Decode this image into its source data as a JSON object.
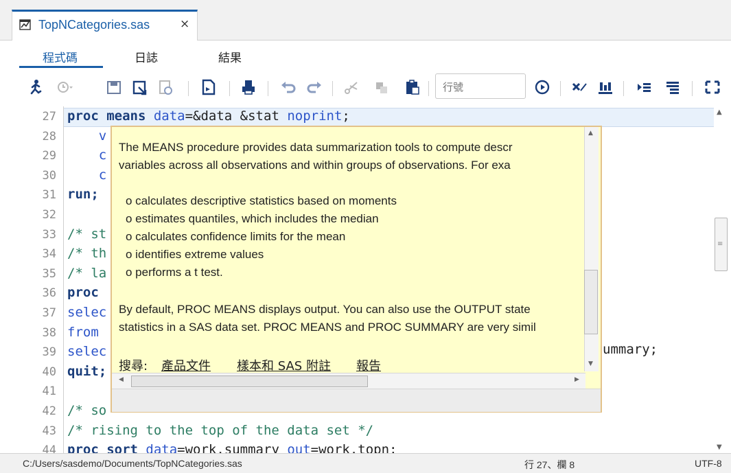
{
  "tab": {
    "filename": "TopNCategories.sas",
    "close": "×"
  },
  "subtabs": [
    "程式碼",
    "日誌",
    "結果"
  ],
  "toolbar": {
    "line_placeholder": "行號"
  },
  "editor": {
    "lines": [
      {
        "n": "27",
        "code": [
          {
            "t": "proc ",
            "c": "kw"
          },
          {
            "t": "means ",
            "c": "kw"
          },
          {
            "t": "data",
            "c": "opt"
          },
          {
            "t": "=&data &stat ",
            "c": ""
          },
          {
            "t": "noprint",
            "c": "opt"
          },
          {
            "t": ";",
            "c": ""
          }
        ]
      },
      {
        "n": "28",
        "code": [
          {
            "t": "    v",
            "c": "opt"
          }
        ]
      },
      {
        "n": "29",
        "code": [
          {
            "t": "    c",
            "c": "opt"
          }
        ]
      },
      {
        "n": "30",
        "code": [
          {
            "t": "    c",
            "c": "opt"
          }
        ]
      },
      {
        "n": "31",
        "code": [
          {
            "t": "run;",
            "c": "kw"
          }
        ]
      },
      {
        "n": "32",
        "code": []
      },
      {
        "n": "33",
        "code": [
          {
            "t": "/* st",
            "c": "cmt"
          }
        ]
      },
      {
        "n": "34",
        "code": [
          {
            "t": "/* th",
            "c": "cmt"
          }
        ]
      },
      {
        "n": "35",
        "code": [
          {
            "t": "/* la",
            "c": "cmt"
          }
        ]
      },
      {
        "n": "36",
        "code": [
          {
            "t": "proc",
            "c": "kw"
          }
        ]
      },
      {
        "n": "37",
        "code": [
          {
            "t": "selec",
            "c": "opt"
          }
        ]
      },
      {
        "n": "38",
        "code": [
          {
            "t": "from",
            "c": "opt"
          }
        ]
      },
      {
        "n": "39",
        "code": [
          {
            "t": "selec",
            "c": "opt"
          }
        ]
      },
      {
        "n": "40",
        "code": [
          {
            "t": "quit;",
            "c": "kw"
          }
        ]
      },
      {
        "n": "41",
        "code": []
      },
      {
        "n": "42",
        "code": [
          {
            "t": "/* so",
            "c": "cmt"
          }
        ]
      },
      {
        "n": "43",
        "code": [
          {
            "t": "/* rising to the top of the data set */",
            "c": "cmt"
          }
        ]
      },
      {
        "n": "44",
        "code": [
          {
            "t": "proc ",
            "c": "kw"
          },
          {
            "t": "sort ",
            "c": "kw"
          },
          {
            "t": "data",
            "c": "opt"
          },
          {
            "t": "=work.summary ",
            "c": ""
          },
          {
            "t": "out",
            "c": "opt"
          },
          {
            "t": "=work.topn;",
            "c": ""
          }
        ]
      }
    ],
    "line39_tail": "ummary;"
  },
  "popup": {
    "para1_l1": "The MEANS procedure provides data summarization tools to compute descr",
    "para1_l2": "variables across all observations and within groups of observations. For exa",
    "bullets": [
      "o calculates descriptive statistics based on moments",
      "o estimates quantiles, which includes the median",
      "o calculates confidence limits for the mean",
      "o identifies extreme values",
      "o performs a t test."
    ],
    "para2_l1": "By default, PROC MEANS displays output. You can also use the OUTPUT state",
    "para2_l2": "statistics in a SAS data set. PROC MEANS and PROC SUMMARY are very simil",
    "search_label": "搜尋:",
    "links": [
      "產品文件",
      "樣本和 SAS 附註",
      "報告"
    ]
  },
  "status": {
    "path": "C:/Users/sasdemo/Documents/TopNCategories.sas",
    "position": "行 27、欄 8",
    "encoding": "UTF-8"
  }
}
